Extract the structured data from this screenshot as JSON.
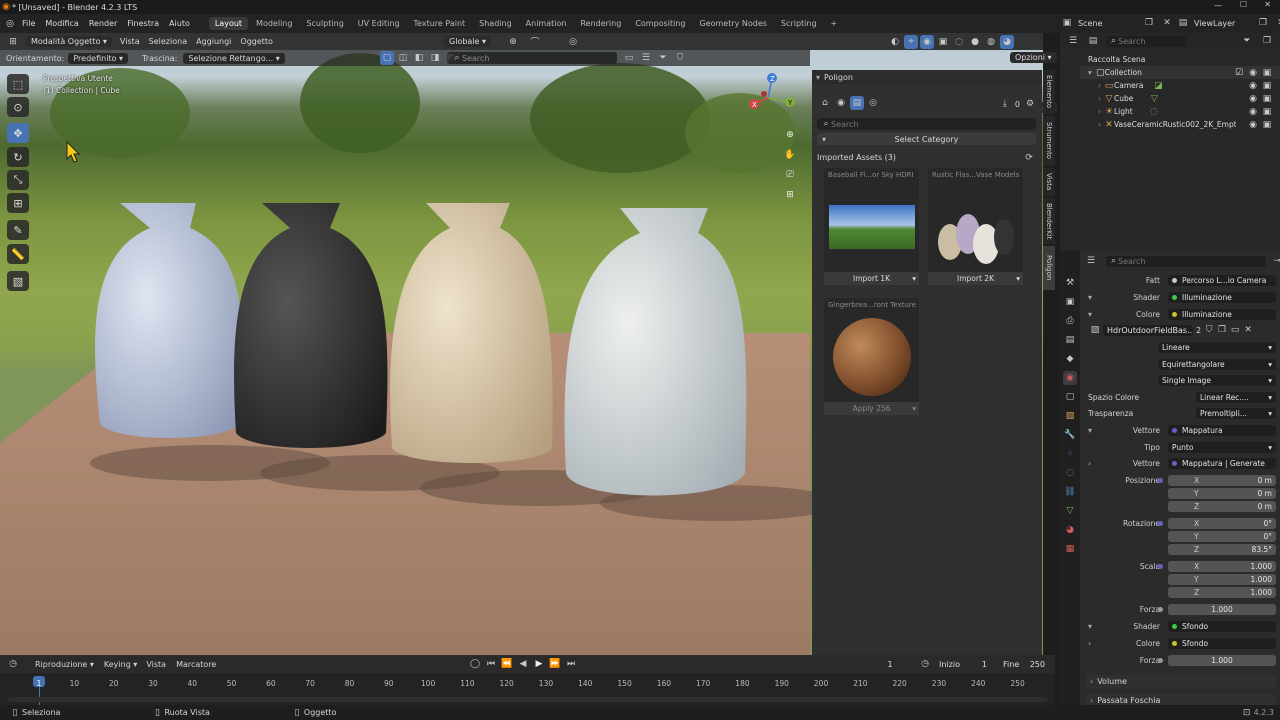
{
  "title_bar": {
    "title": "* [Unsaved] - Blender 4.2.3 LTS"
  },
  "menu": {
    "items": [
      "File",
      "Modifica",
      "Render",
      "Finestra",
      "Aiuto"
    ],
    "workspaces": [
      "Layout",
      "Modeling",
      "Sculpting",
      "UV Editing",
      "Texture Paint",
      "Shading",
      "Animation",
      "Rendering",
      "Compositing",
      "Geometry Nodes",
      "Scripting"
    ],
    "active_workspace": "Layout",
    "scene_label": "Scene",
    "viewlayer_label": "ViewLayer"
  },
  "viewport_header": {
    "mode": "Modalità Oggetto",
    "menus": [
      "Vista",
      "Seleziona",
      "Aggiungi",
      "Oggetto"
    ],
    "transform": "Globale",
    "orient_label": "Orientamento:",
    "orient_value": "Predefinito",
    "drag_label": "Trascina:",
    "drag_value": "Selezione Rettango...",
    "search_placeholder": "Search",
    "options": "Opzioni"
  },
  "viewport_overlay": {
    "line1": "Prospettiva Utente",
    "line2": "(1) Collection | Cube"
  },
  "gizmo": {
    "x": "X",
    "y": "Y",
    "z": "Z"
  },
  "assets_panel": {
    "title": "Poligon",
    "count": "0",
    "search_placeholder": "Search",
    "category": "Select Category",
    "imported_label": "Imported Assets (3)",
    "cards": [
      {
        "title": "Baseball Fi...or Sky HDRI",
        "button": "Import 1K"
      },
      {
        "title": "Rustic Flas...Vase Models",
        "button": "Import 2K"
      },
      {
        "title": "Gingerbrea...ront Texture",
        "button": "Apply 256"
      }
    ]
  },
  "side_tabs": [
    "Elemento",
    "Strumento",
    "Vista",
    "BlenderKit",
    "Poligon"
  ],
  "outliner": {
    "search_placeholder": "Search",
    "root": "Raccolta Scena",
    "collection": "Collection",
    "items": [
      "Camera",
      "Cube",
      "Light",
      "VaseCeramicRustic002_2K_Empty"
    ]
  },
  "properties": {
    "search_placeholder": "Search",
    "rows": {
      "fatt_label": "Fatt",
      "fatt_value": "Percorso L...io Camera",
      "shader_label": "Shader",
      "shader_value": "Illuminazione",
      "colore_label": "Colore",
      "colore_value": "Illuminazione",
      "image_name": "HdrOutdoorFieldBas...",
      "image_users": "2",
      "interp": "Lineare",
      "projection": "Equirettangolare",
      "source": "Single Image",
      "colorspace_label": "Spazio Colore",
      "colorspace_value": "Linear Rec....",
      "alpha_label": "Trasparenza",
      "alpha_value": "Premoltipli...",
      "vettore_label": "Vettore",
      "vettore_value": "Mappatura",
      "tipo_label": "Tipo",
      "tipo_value": "Punto",
      "vettore2_label": "Vettore",
      "vettore2_value": "Mappatura | Generate",
      "pos_label": "Posizione",
      "pos_x": "0 m",
      "pos_y": "0 m",
      "pos_z": "0 m",
      "rot_label": "Rotazione",
      "rot_x": "0°",
      "rot_y": "0°",
      "rot_z": "83.5°",
      "scale_label": "Scala",
      "scale_x": "1.000",
      "scale_y": "1.000",
      "scale_z": "1.000",
      "forza_label": "Forza",
      "forza_value": "1.000",
      "shader2_label": "Shader",
      "shader2_value": "Sfondo",
      "colore2_label": "Colore",
      "colore2_value": "Sfondo",
      "forza2_label": "Forza",
      "forza2_value": "1.000",
      "volume": "Volume",
      "fog": "Passata Foschia"
    }
  },
  "timeline": {
    "menus": [
      "Riproduzione",
      "Keying",
      "Vista",
      "Marcatore"
    ],
    "current_frame": "1",
    "start_label": "Inizio",
    "start": "1",
    "end_label": "Fine",
    "end": "250",
    "ticks": [
      "1",
      "10",
      "20",
      "30",
      "40",
      "50",
      "60",
      "70",
      "80",
      "90",
      "100",
      "110",
      "120",
      "130",
      "140",
      "150",
      "160",
      "170",
      "180",
      "190",
      "200",
      "210",
      "220",
      "230",
      "240",
      "250"
    ]
  },
  "statusbar": {
    "select": "Seleziona",
    "rotate": "Ruota Vista",
    "object": "Oggetto",
    "version": "4.2.3"
  },
  "colors": {
    "accent": "#4772b3",
    "header": "#232323",
    "panel": "#303030"
  }
}
